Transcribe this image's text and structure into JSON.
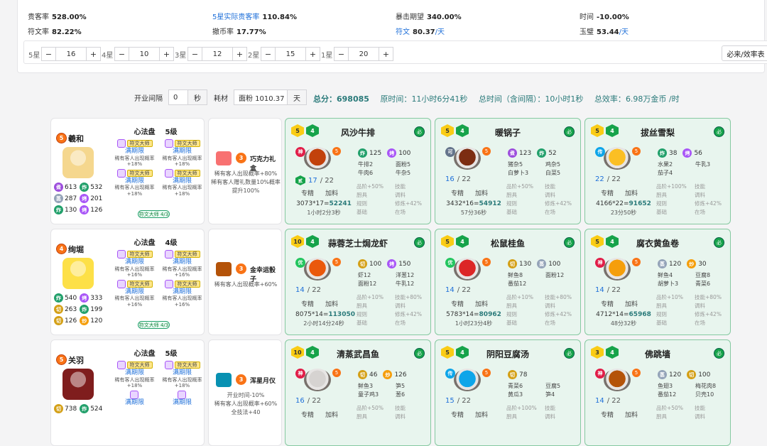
{
  "stats": [
    {
      "label": "贵客率",
      "value": "528.00%",
      "blue": false,
      "unit": ""
    },
    {
      "label": "5星实际贵客率",
      "value": "110.84%",
      "blue": true,
      "unit": ""
    },
    {
      "label": "暴击期望",
      "value": "340.00%",
      "blue": false,
      "unit": ""
    },
    {
      "label": "时间",
      "value": "-10.00%",
      "blue": false,
      "unit": ""
    },
    {
      "label": "符文率",
      "value": "82.22%",
      "blue": false,
      "unit": ""
    },
    {
      "label": "撤币率",
      "value": "17.77%",
      "blue": false,
      "unit": ""
    },
    {
      "label": "符文",
      "value": "80.37",
      "blue": true,
      "unit": "/天"
    },
    {
      "label": "玉璧",
      "value": "53.44",
      "blue": false,
      "unit": "/天"
    }
  ],
  "stars": [
    {
      "label": "5星",
      "value": "16"
    },
    {
      "label": "4星",
      "value": "10"
    },
    {
      "label": "3星",
      "value": "12"
    },
    {
      "label": "2星",
      "value": "15"
    },
    {
      "label": "1星",
      "value": "20"
    }
  ],
  "eff_button": "必来/效率表",
  "controls": {
    "interval_label": "开业间隔",
    "interval_value": "0",
    "interval_unit": "秒",
    "material_label": "耗材",
    "material_value": "面粉 1010.37",
    "material_unit": "天"
  },
  "totals": {
    "score_label": "总分：",
    "score": "698085",
    "orig_label": "原时间：",
    "orig": "11小时6分41秒",
    "total_label": "总时间（含间隔）：",
    "total": "10小时1秒",
    "eff_label": "总效率：",
    "eff": "6.98万金币 /时"
  },
  "rows": [
    {
      "chef": {
        "name": "羲和",
        "rank": "5",
        "avatar": "#f5d78e",
        "skills": [
          [
            "zhu",
            "613"
          ],
          [
            "zha",
            "532"
          ],
          [
            "zhen",
            "287"
          ],
          [
            "kao",
            "201"
          ],
          [
            "zha",
            "130"
          ],
          [
            "kao",
            "126"
          ]
        ],
        "title": "心法盘",
        "level": "5级",
        "runes": [
          {
            "tag": "符文大师",
            "name": "满期限",
            "desc": "稀有客人出现概率",
            "pct": "+18%"
          },
          {
            "tag": "符文大师",
            "name": "满期限",
            "desc": "稀有客人出现概率",
            "pct": "+18%"
          },
          {
            "tag": "符文大师",
            "name": "满期限",
            "desc": "稀有客人出现概率",
            "pct": "+18%"
          },
          {
            "tag": "符文大师",
            "name": "满期限",
            "desc": "稀有客人出现概率",
            "pct": "+18%"
          }
        ],
        "master": "符文大师 4/3"
      },
      "equip": {
        "name": "巧克力礼盒",
        "badge": "3",
        "desc": "稀有客人出现概率+80%\n稀有客人赠礼数量10%概率提升100%",
        "color": "#f87171"
      },
      "recipes": [
        {
          "name": "风沙牛排",
          "top": "5",
          "grade": "4",
          "rank": "神",
          "rank_c": "shen",
          "badge": "5",
          "count": "17",
          "total": "/ 22",
          "lvl": "贰",
          "skills": [
            [
              "zha",
              "125"
            ],
            [
              "kao",
              "100"
            ]
          ],
          "mats": [
            "牛排2",
            "面粉5",
            "牛肉6",
            "牛杂5"
          ],
          "f_pre": "3073*17=",
          "f_val": "52241",
          "time": "1小时2分3秒",
          "bon": [
            "品阶+50%",
            "技能",
            "厨具",
            "调料",
            "规则",
            "修炼+42%",
            "基础",
            "在场"
          ],
          "dish": "#c2410c"
        },
        {
          "name": "暖锅子",
          "top": "5",
          "grade": "4",
          "rank": "可",
          "rank_c": "ke",
          "badge": "5",
          "count": "16",
          "total": "/ 22",
          "lvl": "",
          "skills": [
            [
              "zhu",
              "123"
            ],
            [
              "zha",
              "52"
            ]
          ],
          "mats": [
            "猪杂5",
            "鸡杂5",
            "白萝卜3",
            "白菜5"
          ],
          "f_pre": "3432*16=",
          "f_val": "54912",
          "time": "57分36秒",
          "bon": [
            "品阶+50%",
            "技能",
            "厨具",
            "调料",
            "规则",
            "修炼+42%",
            "基础",
            "在场"
          ],
          "dish": "#7c2d12"
        },
        {
          "name": "拔丝雪梨",
          "top": "5",
          "grade": "4",
          "rank": "传",
          "rank_c": "chuan",
          "badge": "5",
          "count": "22",
          "total": "/ 22",
          "lvl": "",
          "skills": [
            [
              "zha",
              "38"
            ],
            [
              "kao",
              "56"
            ]
          ],
          "mats": [
            "水果2",
            "牛乳3",
            "茄子4",
            ""
          ],
          "f_pre": "4166*22=",
          "f_val": "91652",
          "time": "23分50秒",
          "bon": [
            "品阶+100%",
            "技能",
            "厨具",
            "调料",
            "规则",
            "修炼+42%",
            "基础",
            "在场"
          ],
          "dish": "#fbbf24"
        }
      ]
    },
    {
      "chef": {
        "name": "绚堀",
        "rank": "4",
        "avatar": "#fde047",
        "skills": [
          [
            "zha",
            "540"
          ],
          [
            "kao",
            "333"
          ],
          [
            "qie",
            "263"
          ],
          [
            "zha",
            "199"
          ],
          [
            "qie",
            "126"
          ],
          [
            "chao",
            "120"
          ]
        ],
        "title": "心法盘",
        "level": "4级",
        "runes": [
          {
            "tag": "符文大师",
            "name": "满期限",
            "desc": "稀有客人出现概率",
            "pct": "+16%"
          },
          {
            "tag": "符文大师",
            "name": "满期限",
            "desc": "稀有客人出现概率",
            "pct": "+16%"
          },
          {
            "tag": "符文大师",
            "name": "满期限",
            "desc": "稀有客人出现概率",
            "pct": "+16%"
          },
          {
            "tag": "符文大师",
            "name": "满期限",
            "desc": "稀有客人出现概率",
            "pct": "+16%"
          }
        ],
        "master": "符文大师 4/3"
      },
      "equip": {
        "name": "金幸运骰子",
        "badge": "3",
        "desc": "稀有客人出现概率+60%",
        "color": "#b45309"
      },
      "recipes": [
        {
          "name": "蒜蓉芝士焗龙虾",
          "top": "10",
          "grade": "4",
          "rank": "优",
          "rank_c": "you",
          "badge": "5",
          "count": "14",
          "total": "/ 22",
          "lvl": "",
          "skills": [
            [
              "qie",
              "100"
            ],
            [
              "kao",
              "150"
            ]
          ],
          "mats": [
            "虾12",
            "洋葱12",
            "面粉12",
            "牛乳12"
          ],
          "f_pre": "8075*14=",
          "f_val": "113050",
          "time": "2小时14分24秒",
          "bon": [
            "品阶+10%",
            "技能+80%",
            "厨具",
            "调料",
            "规则",
            "修炼+42%",
            "基础",
            "在场"
          ],
          "dish": "#ea580c"
        },
        {
          "name": "松鼠桂鱼",
          "top": "5",
          "grade": "4",
          "rank": "优",
          "rank_c": "you",
          "badge": "5",
          "count": "14",
          "total": "/ 22",
          "lvl": "",
          "skills": [
            [
              "qie",
              "130"
            ],
            [
              "zhen",
              "100"
            ]
          ],
          "mats": [
            "鲜鱼8",
            "面粉12",
            "番茄12",
            ""
          ],
          "f_pre": "5783*14=",
          "f_val": "80962",
          "time": "1小时23分4秒",
          "bon": [
            "品阶+10%",
            "技能+80%",
            "厨具",
            "调料",
            "规则",
            "修炼+42%",
            "基础",
            "在场"
          ],
          "dish": "#dc2626"
        },
        {
          "name": "腐衣黄鱼卷",
          "top": "5",
          "grade": "4",
          "rank": "神",
          "rank_c": "shen",
          "badge": "5",
          "count": "14",
          "total": "/ 22",
          "lvl": "",
          "skills": [
            [
              "zhen",
              "120"
            ],
            [
              "chao",
              "30"
            ]
          ],
          "mats": [
            "鲜鱼4",
            "豆腐8",
            "胡萝卜3",
            "青菜6"
          ],
          "f_pre": "4712*14=",
          "f_val": "65968",
          "time": "48分32秒",
          "bon": [
            "品阶+10%",
            "技能+80%",
            "厨具",
            "调料",
            "规则",
            "修炼+42%",
            "基础",
            "在场"
          ],
          "dish": "#f59e0b"
        }
      ]
    },
    {
      "chef": {
        "name": "关羽",
        "rank": "5",
        "avatar": "#7f1d1d",
        "skills": [
          [
            "qie",
            "738"
          ],
          [
            "zha",
            "524"
          ]
        ],
        "title": "心法盘",
        "level": "5级",
        "runes": [
          {
            "tag": "符文大师",
            "name": "满期限",
            "desc": "稀有客人出现概率",
            "pct": "+18%"
          },
          {
            "tag": "符文大师",
            "name": "满期限",
            "desc": "稀有客人出现概率",
            "pct": "+18%"
          },
          {
            "tag": "",
            "name": "满期限",
            "desc": "",
            "pct": ""
          },
          {
            "tag": "",
            "name": "满期限",
            "desc": "",
            "pct": ""
          }
        ],
        "master": ""
      },
      "equip": {
        "name": "浑星月仪",
        "badge": "3",
        "desc": "开业时间-10%\n稀有客人出现概率+60%\n全技法+40",
        "color": "#0891b2"
      },
      "recipes": [
        {
          "name": "清蒸武昌鱼",
          "top": "10",
          "grade": "4",
          "rank": "神",
          "rank_c": "shen",
          "badge": "5",
          "count": "16",
          "total": "/ 22",
          "lvl": "",
          "skills": [
            [
              "qie",
              "46"
            ],
            [
              "chao",
              "126"
            ]
          ],
          "mats": [
            "鲜鱼3",
            "笋5",
            "童子鸡3",
            "葱6"
          ],
          "f_pre": "",
          "f_val": "",
          "time": "",
          "bon": [
            "品阶+50%",
            "技能",
            "厨具",
            "调料",
            "",
            "",
            "",
            ""
          ],
          "dish": "#d6d3d1"
        },
        {
          "name": "阴阳豆腐汤",
          "top": "5",
          "grade": "4",
          "rank": "传",
          "rank_c": "chuan",
          "badge": "5",
          "count": "15",
          "total": "/ 22",
          "lvl": "",
          "skills": [
            [
              "qie",
              "78"
            ]
          ],
          "mats": [
            "青菜6",
            "豆腐5",
            "黄瓜3",
            "笋4"
          ],
          "f_pre": "",
          "f_val": "",
          "time": "",
          "bon": [
            "品阶+100%",
            "技能",
            "厨具",
            "调料",
            "",
            "",
            "",
            ""
          ],
          "dish": "#0ea5e9"
        },
        {
          "name": "佛跳墙",
          "top": "3",
          "grade": "4",
          "rank": "神",
          "rank_c": "shen",
          "badge": "5",
          "count": "14",
          "total": "/ 22",
          "lvl": "",
          "skills": [
            [
              "zhen",
              "120"
            ],
            [
              "qie",
              "100"
            ]
          ],
          "mats": [
            "鱼翅3",
            "梅花肉8",
            "番茄12",
            "贝壳10"
          ],
          "f_pre": "",
          "f_val": "",
          "time": "",
          "bon": [
            "品阶+50%",
            "技能",
            "厨具",
            "调料",
            "",
            "",
            "",
            ""
          ],
          "dish": "#b45309"
        }
      ]
    }
  ],
  "labels": {
    "zhuanjing": "专精",
    "jialiao": "加料",
    "must": "必"
  },
  "skill_glyphs": {
    "zhu": "煮",
    "zha": "炸",
    "qie": "切",
    "zhen": "蒸",
    "kao": "烤",
    "chao": "炒"
  }
}
